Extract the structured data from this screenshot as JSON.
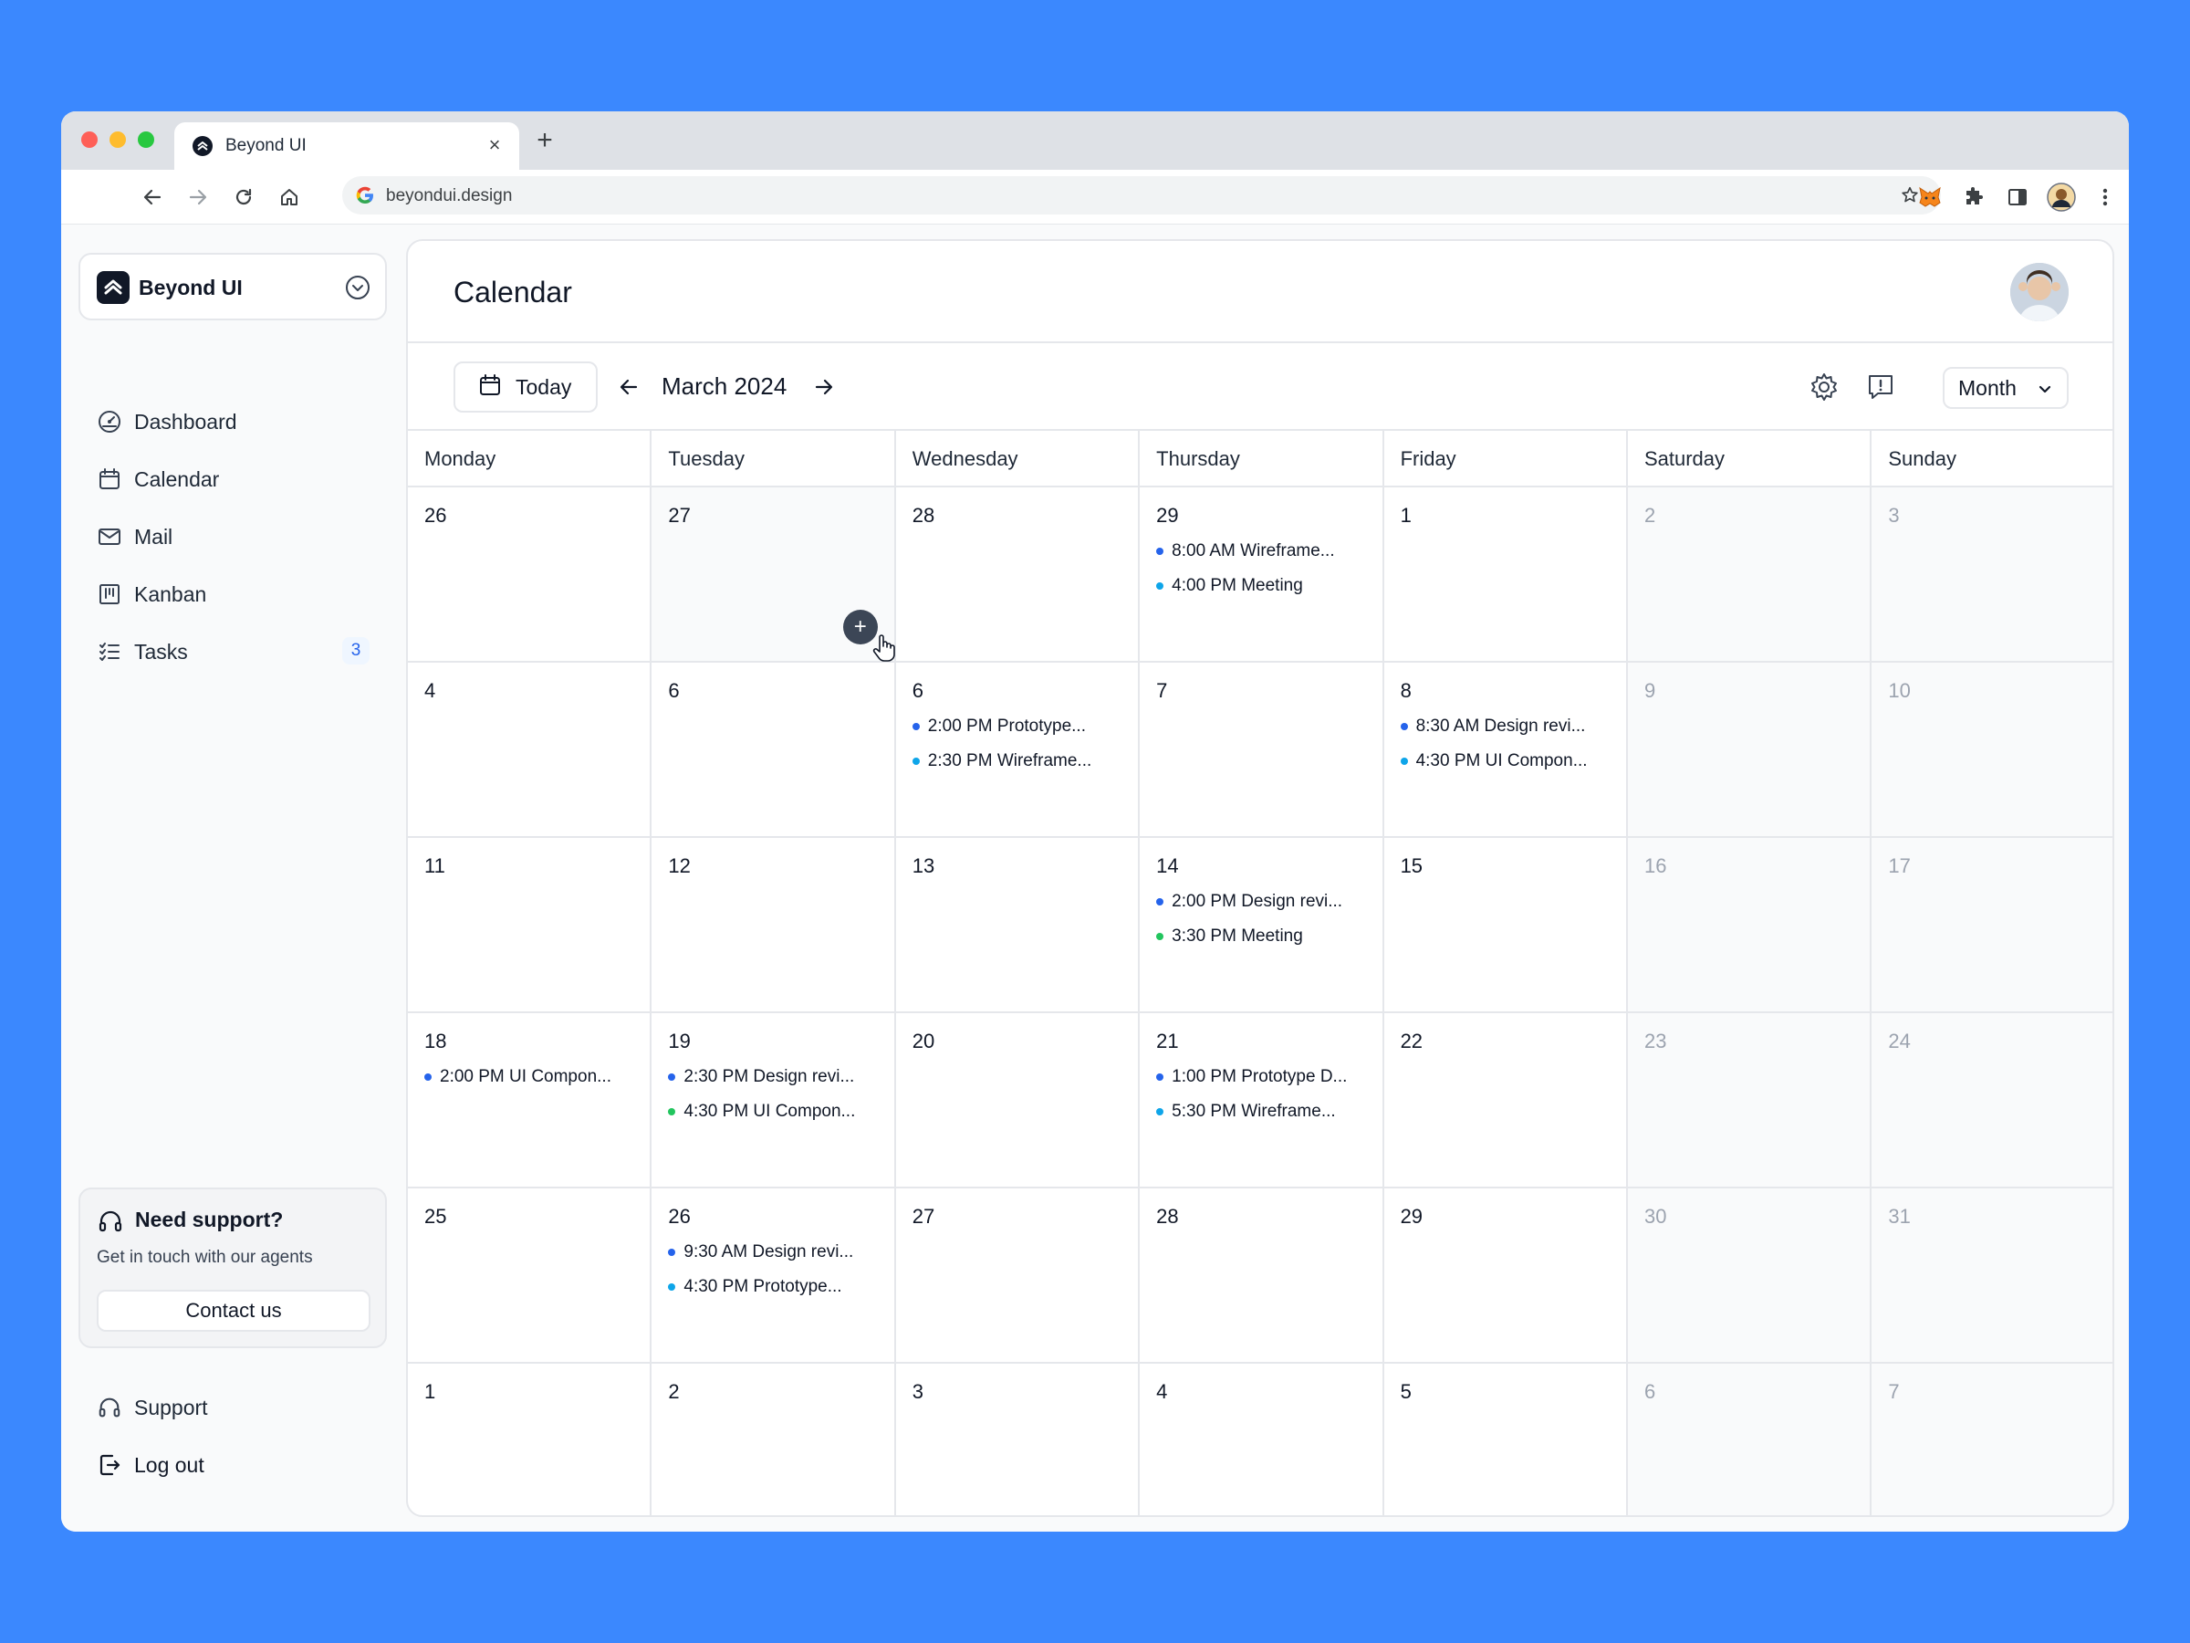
{
  "browser": {
    "tab_title": "Beyond UI",
    "close_glyph": "×",
    "new_tab_glyph": "+",
    "url": "beyondui.design"
  },
  "sidebar": {
    "workspace_name": "Beyond UI",
    "nav": [
      {
        "label": "Dashboard",
        "icon": "dashboard-icon"
      },
      {
        "label": "Calendar",
        "icon": "calendar-icon"
      },
      {
        "label": "Mail",
        "icon": "mail-icon"
      },
      {
        "label": "Kanban",
        "icon": "kanban-icon"
      },
      {
        "label": "Tasks",
        "icon": "tasks-icon",
        "badge": "3"
      }
    ],
    "support_card": {
      "title": "Need support?",
      "subtitle": "Get in touch with our agents",
      "button": "Contact us"
    },
    "bottom": [
      {
        "label": "Support",
        "icon": "headset-icon"
      },
      {
        "label": "Log out",
        "icon": "logout-icon"
      }
    ]
  },
  "main": {
    "title": "Calendar",
    "today_label": "Today",
    "month_label": "March 2024",
    "view_label": "Month",
    "weekdays": [
      "Monday",
      "Tuesday",
      "Wednesday",
      "Thursday",
      "Friday",
      "Saturday",
      "Sunday"
    ],
    "add_glyph": "+",
    "event_colors": {
      "blue": "#2563eb",
      "lightblue": "#0ea5e9",
      "green": "#22c55e"
    },
    "weeks": [
      [
        {
          "day": "26",
          "events": []
        },
        {
          "day": "27",
          "events": [],
          "hover": true
        },
        {
          "day": "28",
          "events": []
        },
        {
          "day": "29",
          "events": [
            {
              "text": "8:00 AM Wireframe...",
              "color": "blue"
            },
            {
              "text": "4:00 PM Meeting",
              "color": "lightblue"
            }
          ]
        },
        {
          "day": "1",
          "events": []
        },
        {
          "day": "2",
          "events": [],
          "weekend": true
        },
        {
          "day": "3",
          "events": [],
          "weekend": true
        }
      ],
      [
        {
          "day": "4",
          "events": []
        },
        {
          "day": "6",
          "events": []
        },
        {
          "day": "6",
          "events": [
            {
              "text": "2:00 PM Prototype...",
              "color": "blue"
            },
            {
              "text": "2:30 PM Wireframe...",
              "color": "lightblue"
            }
          ]
        },
        {
          "day": "7",
          "events": []
        },
        {
          "day": "8",
          "events": [
            {
              "text": "8:30 AM Design revi...",
              "color": "blue"
            },
            {
              "text": "4:30 PM UI Compon...",
              "color": "lightblue"
            }
          ]
        },
        {
          "day": "9",
          "events": [],
          "weekend": true
        },
        {
          "day": "10",
          "events": [],
          "weekend": true
        }
      ],
      [
        {
          "day": "11",
          "events": []
        },
        {
          "day": "12",
          "events": []
        },
        {
          "day": "13",
          "events": []
        },
        {
          "day": "14",
          "events": [
            {
              "text": "2:00 PM Design revi...",
              "color": "blue"
            },
            {
              "text": "3:30 PM Meeting",
              "color": "green"
            }
          ]
        },
        {
          "day": "15",
          "events": []
        },
        {
          "day": "16",
          "events": [],
          "weekend": true
        },
        {
          "day": "17",
          "events": [],
          "weekend": true
        }
      ],
      [
        {
          "day": "18",
          "events": [
            {
              "text": "2:00 PM UI Compon...",
              "color": "blue"
            }
          ]
        },
        {
          "day": "19",
          "events": [
            {
              "text": "2:30 PM Design revi...",
              "color": "blue"
            },
            {
              "text": "4:30 PM UI Compon...",
              "color": "green"
            }
          ]
        },
        {
          "day": "20",
          "events": []
        },
        {
          "day": "21",
          "events": [
            {
              "text": "1:00 PM Prototype D...",
              "color": "blue"
            },
            {
              "text": "5:30 PM Wireframe...",
              "color": "lightblue"
            }
          ]
        },
        {
          "day": "22",
          "events": []
        },
        {
          "day": "23",
          "events": [],
          "weekend": true
        },
        {
          "day": "24",
          "events": [],
          "weekend": true
        }
      ],
      [
        {
          "day": "25",
          "events": []
        },
        {
          "day": "26",
          "events": [
            {
              "text": "9:30 AM Design revi...",
              "color": "blue"
            },
            {
              "text": "4:30 PM Prototype...",
              "color": "lightblue"
            }
          ]
        },
        {
          "day": "27",
          "events": []
        },
        {
          "day": "28",
          "events": []
        },
        {
          "day": "29",
          "events": []
        },
        {
          "day": "30",
          "events": [],
          "weekend": true
        },
        {
          "day": "31",
          "events": [],
          "weekend": true
        }
      ],
      [
        {
          "day": "1",
          "events": []
        },
        {
          "day": "2",
          "events": []
        },
        {
          "day": "3",
          "events": []
        },
        {
          "day": "4",
          "events": []
        },
        {
          "day": "5",
          "events": []
        },
        {
          "day": "6",
          "events": [],
          "weekend": true
        },
        {
          "day": "7",
          "events": [],
          "weekend": true
        }
      ]
    ]
  }
}
